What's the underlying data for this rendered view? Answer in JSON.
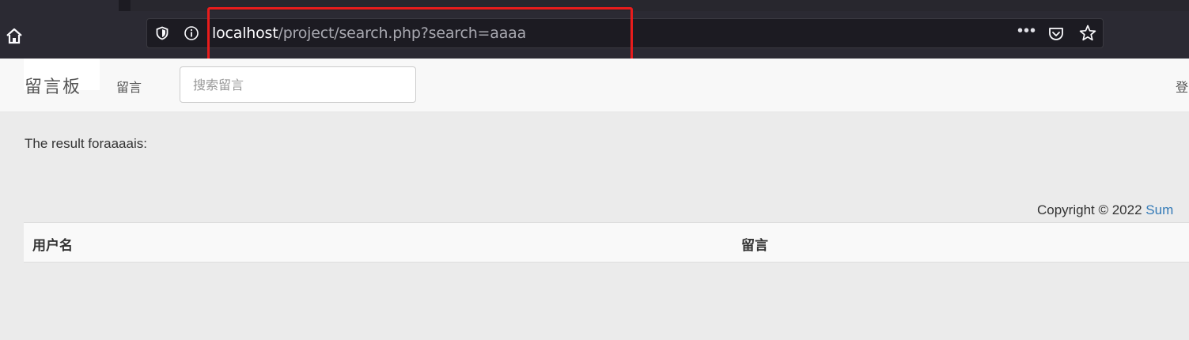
{
  "browser": {
    "url_host": "localhost",
    "url_path": "/project/search.php?search=aaaa",
    "more_label": "•••",
    "icons": [
      "home-icon",
      "shield-icon",
      "info-icon",
      "pocket-icon",
      "star-icon"
    ],
    "highlight_color": "#e81c1c"
  },
  "navbar": {
    "brand": "留言板",
    "nav_link": "留言",
    "search_placeholder": "搜索留言",
    "login": "登"
  },
  "main": {
    "result_text": "The result foraaaais:",
    "copyright_text": "Copyright © 2022 ",
    "copyright_link": "Sum"
  },
  "table": {
    "headers": [
      "用户名",
      "留言"
    ]
  },
  "colors": {
    "page_bg": "#ebebeb",
    "navbar_bg": "#f8f8f8",
    "link": "#337ab7"
  }
}
